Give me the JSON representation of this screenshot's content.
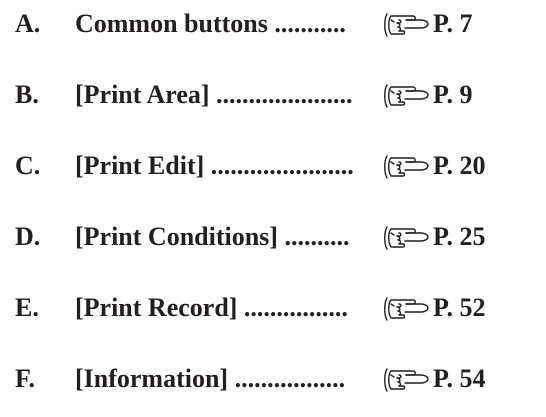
{
  "toc": {
    "items": [
      {
        "letter": "A.",
        "title_leader": "Common buttons ...........",
        "page_ref": "P. 7"
      },
      {
        "letter": "B.",
        "title_leader": "[Print Area] .....................",
        "page_ref": "P. 9"
      },
      {
        "letter": "C.",
        "title_leader": "[Print Edit] ......................",
        "page_ref": "P. 20"
      },
      {
        "letter": "D.",
        "title_leader": "[Print Conditions] ..........",
        "page_ref": "P. 25"
      },
      {
        "letter": "E.",
        "title_leader": "[Print Record] ................",
        "page_ref": "P. 52"
      },
      {
        "letter": "F.",
        "title_leader": "[Information] .................",
        "page_ref": "P. 54"
      }
    ],
    "pointer_icon": "pointing-hand-icon"
  }
}
